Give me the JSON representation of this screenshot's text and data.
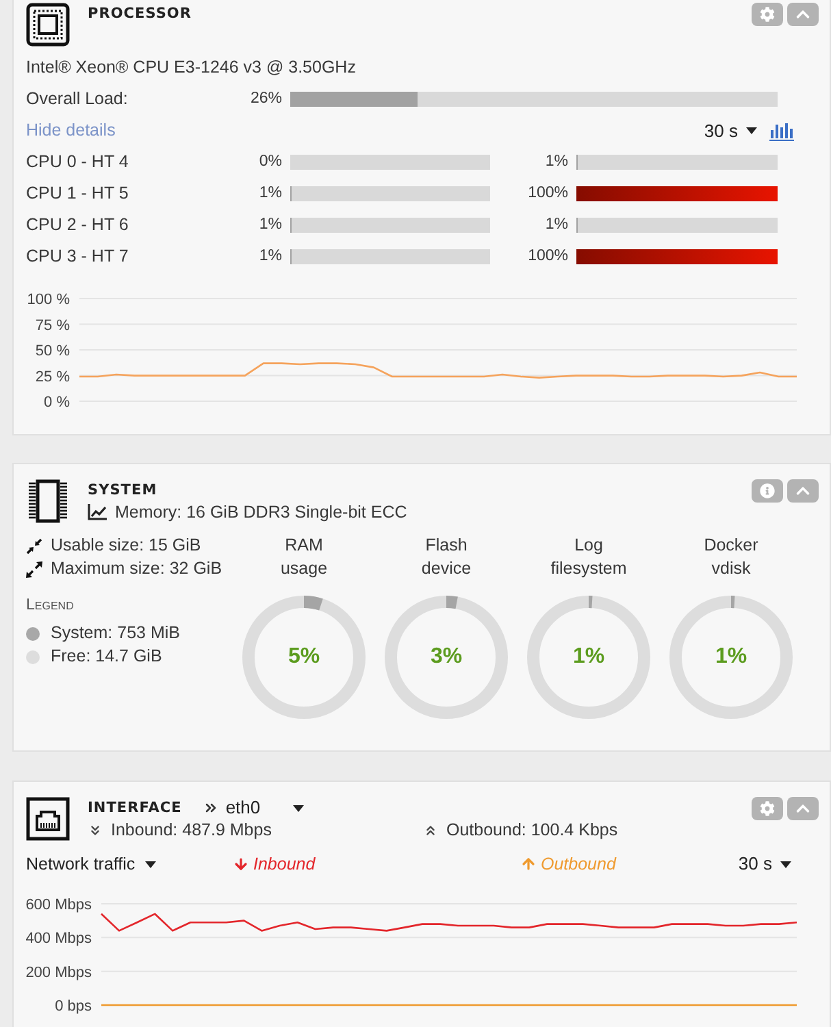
{
  "processor": {
    "title": "PROCESSOR",
    "model": "Intel® Xeon® CPU E3-1246 v3 @ 3.50GHz",
    "overall": {
      "label": "Overall Load:",
      "reading": "26%",
      "level": 0.26
    },
    "details_link": "Hide details",
    "interval": "30 s",
    "cpus": [
      {
        "label": "CPU 0 - HT 4",
        "threads": [
          {
            "reading": "0%",
            "level": 0
          },
          {
            "reading": "1%",
            "level": 0.01
          }
        ]
      },
      {
        "label": "CPU 1 - HT 5",
        "threads": [
          {
            "reading": "1%",
            "level": 0.01
          },
          {
            "reading": "100%",
            "level": 1
          }
        ]
      },
      {
        "label": "CPU 2 - HT 6",
        "threads": [
          {
            "reading": "1%",
            "level": 0.01
          },
          {
            "reading": "1%",
            "level": 0.01
          }
        ]
      },
      {
        "label": "CPU 3 - HT 7",
        "threads": [
          {
            "reading": "1%",
            "level": 0.01
          },
          {
            "reading": "100%",
            "level": 1
          }
        ]
      }
    ],
    "chart_data": {
      "type": "line",
      "grid": true,
      "ylim": [
        0,
        100
      ],
      "yticks": [
        {
          "value": 100,
          "label": "100 %"
        },
        {
          "value": 75,
          "label": "75 %"
        },
        {
          "value": 50,
          "label": "50 %"
        },
        {
          "value": 25,
          "label": "25 %"
        },
        {
          "value": 0,
          "label": "0 %"
        }
      ],
      "series": [
        {
          "color": "#f5a35c",
          "values": [
            24,
            24,
            26,
            25,
            25,
            25,
            25,
            25,
            25,
            25,
            37,
            37,
            36,
            37,
            37,
            36,
            33,
            24,
            24,
            24,
            24,
            24,
            24,
            26,
            24,
            23,
            24,
            25,
            25,
            25,
            24,
            24,
            25,
            25,
            25,
            24,
            25,
            28,
            24,
            24
          ]
        }
      ]
    }
  },
  "system": {
    "title": "SYSTEM",
    "memory": "Memory: 16 GiB DDR3 Single-bit ECC",
    "sizes": [
      "Usable size: 15 GiB",
      "Maximum size: 32 GiB"
    ],
    "legend": {
      "title": "Legend",
      "items": [
        {
          "label": "System: 753 MiB",
          "color": "#a8a8a8"
        },
        {
          "label": "Free: 14.7 GiB",
          "color": "#dddddd"
        }
      ]
    },
    "gauges": [
      {
        "label": "RAM usage",
        "reading": "5%",
        "level": 0.05
      },
      {
        "label": "Flash device",
        "reading": "3%",
        "level": 0.03
      },
      {
        "label": "Log filesystem",
        "reading": "1%",
        "level": 0.01
      },
      {
        "label": "Docker vdisk",
        "reading": "1%",
        "level": 0.01
      }
    ]
  },
  "interface": {
    "title": "INTERFACE",
    "port": "eth0",
    "inbound": "Inbound: 487.9 Mbps",
    "outbound": "Outbound: 100.4 Kbps",
    "view": "Network traffic",
    "interval": "30 s",
    "chart_data": {
      "type": "line",
      "grid": true,
      "ylim": [
        0,
        600
      ],
      "yticks": [
        {
          "value": 600,
          "label": "600 Mbps"
        },
        {
          "value": 400,
          "label": "400 Mbps"
        },
        {
          "value": 200,
          "label": "200 Mbps"
        },
        {
          "value": 0,
          "label": "0 bps"
        }
      ],
      "series": [
        {
          "name": "Inbound",
          "color": "#e3262b",
          "values": [
            540,
            440,
            490,
            540,
            440,
            490,
            490,
            490,
            500,
            440,
            470,
            490,
            450,
            460,
            460,
            450,
            440,
            460,
            480,
            480,
            470,
            470,
            470,
            460,
            460,
            480,
            480,
            480,
            470,
            460,
            460,
            460,
            480,
            480,
            480,
            470,
            470,
            480,
            480,
            490
          ]
        },
        {
          "name": "Outbound",
          "color": "#ef9a2e",
          "values": [
            0,
            0,
            0,
            0,
            0,
            0,
            0,
            0,
            0,
            0,
            0,
            0,
            0,
            0,
            0,
            0,
            0,
            0,
            0,
            0,
            0,
            0,
            0,
            0,
            0,
            0,
            0,
            0,
            0,
            0,
            0,
            0,
            0,
            0,
            0,
            0,
            0,
            0,
            0,
            0
          ]
        }
      ]
    }
  }
}
